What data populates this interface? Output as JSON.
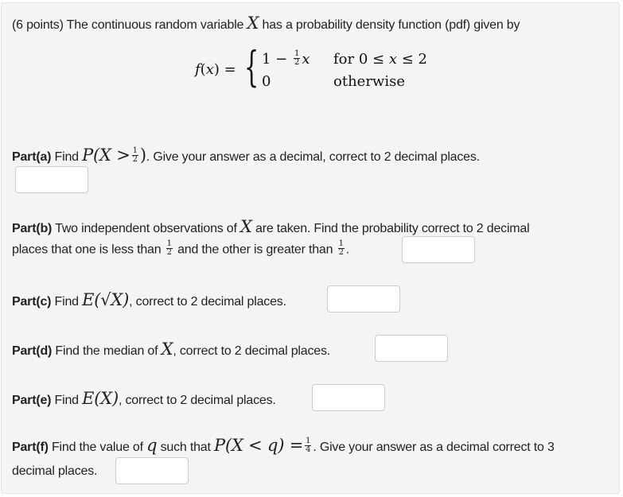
{
  "intro": {
    "points": "(6 points)",
    "text_before": "The continuous random variable",
    "var": "X",
    "text_after": "has a probability density function (pdf) given by"
  },
  "pdf": {
    "lhs": "f(x) =",
    "case1_expr_a": "1 −",
    "case1_frac_num": "1",
    "case1_frac_den": "2",
    "case1_expr_b": "x",
    "case1_cond_word": "for 0 ≤",
    "case1_cond_var": "x",
    "case1_cond_end": "≤ 2",
    "case2_expr": "0",
    "case2_cond": "otherwise"
  },
  "parts": {
    "a": {
      "label": "Part(a)",
      "text1": "Find",
      "math": "P(X >",
      "frac_num": "1",
      "frac_den": "2",
      "math_close": ")",
      "text2": ". Give your answer as a decimal, correct to 2 decimal places.",
      "answer": ""
    },
    "b": {
      "label": "Part(b)",
      "text1": "Two independent observations of",
      "var": "X",
      "text2": "are taken. Find the probability correct to 2 decimal",
      "line2_a": "places that one is less than",
      "frac_num": "1",
      "frac_den": "2",
      "line2_b": "and the other is greater than",
      "line2_end": ".",
      "answer": ""
    },
    "c": {
      "label": "Part(c)",
      "text1": "Find",
      "math": "E(√X)",
      "text2": ", correct to 2 decimal places.",
      "answer": ""
    },
    "d": {
      "label": "Part(d)",
      "text1": "Find the median of",
      "var": "X",
      "text2": ", correct to 2 decimal places.",
      "answer": ""
    },
    "e": {
      "label": "Part(e)",
      "text1": "Find",
      "math": "E(X)",
      "text2": ", correct to 2 decimal places.",
      "answer": ""
    },
    "f": {
      "label": "Part(f)",
      "text1": "Find the value of",
      "var": "q",
      "text2": "such that",
      "math": "P(X < q) =",
      "frac_num": "1",
      "frac_den": "4",
      "text3": ". Give your answer as a decimal correct to 3",
      "line2": "decimal places.",
      "answer": ""
    }
  }
}
